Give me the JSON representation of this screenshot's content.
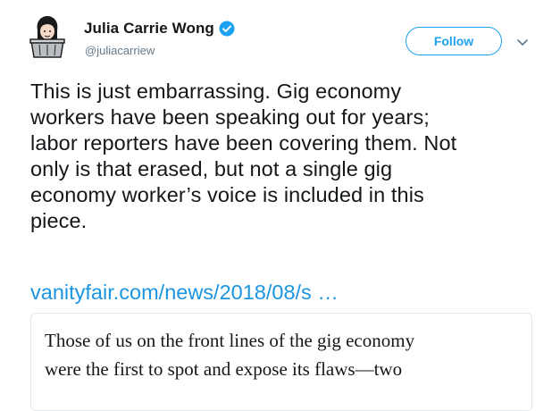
{
  "tweet": {
    "author": {
      "name": "Julia Carrie Wong",
      "handle": "@juliacarriew",
      "verified": true,
      "avatar_icon": "avatar-illustration"
    },
    "follow_label": "Follow",
    "menu_icon": "chevron-down-icon",
    "text_lines": [
      "This is just embarrassing. Gig economy",
      "workers have been speaking out for years;",
      "labor reporters have been covering them. Not",
      "only is that erased, but not a single gig",
      "economy worker’s voice is included in this",
      "piece."
    ],
    "link_text": "vanityfair.com/news/2018/08/s  …",
    "card": {
      "text_lines": [
        "Those of us on the front lines of the gig economy",
        "were the first to spot and expose its flaws—two"
      ]
    }
  },
  "colors": {
    "accent": "#1da1f2",
    "link": "#1b95e0",
    "text": "#14171a",
    "muted": "#657786",
    "border": "#e1e8ed"
  }
}
